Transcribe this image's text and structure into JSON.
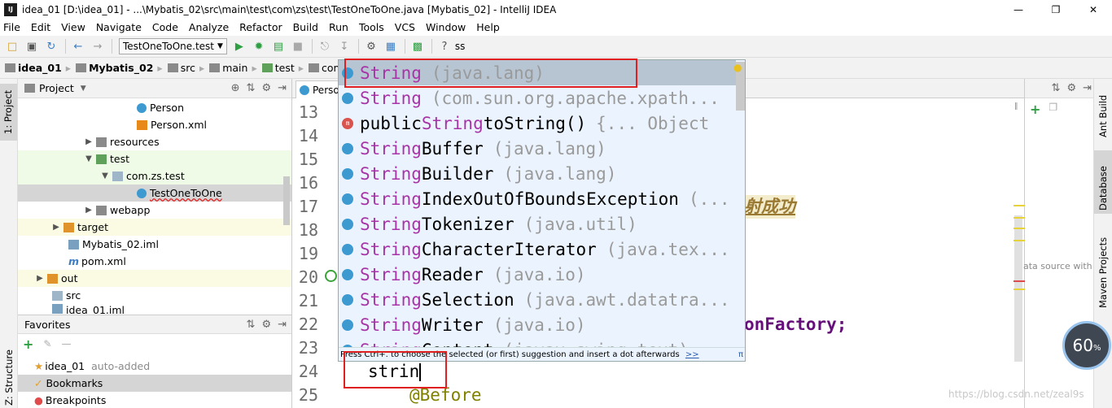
{
  "window": {
    "title": "idea_01 [D:\\idea_01] - ...\\Mybatis_02\\src\\main\\test\\com\\zs\\test\\TestOneToOne.java [Mybatis_02] - IntelliJ IDEA"
  },
  "menu": [
    "File",
    "Edit",
    "View",
    "Navigate",
    "Code",
    "Analyze",
    "Refactor",
    "Build",
    "Run",
    "Tools",
    "VCS",
    "Window",
    "Help"
  ],
  "toolbar": {
    "run_config": "TestOneToOne.test",
    "search_text": "ss"
  },
  "breadcrumb": [
    "idea_01",
    "Mybatis_02",
    "src",
    "main",
    "test",
    "com"
  ],
  "project_panel": {
    "title": "Project",
    "items": [
      {
        "label": "Person",
        "icon": "class-icon"
      },
      {
        "label": "Person.xml",
        "icon": "xml-icon"
      },
      {
        "label": "resources",
        "icon": "folder-icon"
      },
      {
        "label": "test",
        "icon": "folder-icon"
      },
      {
        "label": "com.zs.test",
        "icon": "package-icon"
      },
      {
        "label": "TestOneToOne",
        "icon": "class-icon"
      },
      {
        "label": "webapp",
        "icon": "folder-icon"
      },
      {
        "label": "target",
        "icon": "folder-icon"
      },
      {
        "label": "Mybatis_02.iml",
        "icon": "file-icon"
      },
      {
        "label": "pom.xml",
        "icon": "maven-icon"
      },
      {
        "label": "out",
        "icon": "folder-icon"
      },
      {
        "label": "src",
        "icon": "folder-icon"
      },
      {
        "label": "idea_01.iml",
        "icon": "file-icon"
      }
    ]
  },
  "favorites_panel": {
    "title": "Favorites",
    "items": [
      {
        "label": "idea_01",
        "note": "auto-added"
      },
      {
        "label": "Bookmarks",
        "note": ""
      },
      {
        "label": "Breakpoints",
        "note": ""
      }
    ]
  },
  "left_strip": {
    "project_tab": "1: Project",
    "structure_tab": "Z: Structure"
  },
  "right_strip": {
    "ant": "Ant Build",
    "database": "Database",
    "maven": "Maven Projects"
  },
  "right_panel": {
    "text": "ata source with"
  },
  "editor": {
    "tab_label": "Perso",
    "line_numbers": [
      "13",
      "14",
      "15",
      "16",
      "17",
      "18",
      "19",
      "20",
      "21",
      "22",
      "23",
      "24",
      "25"
    ],
    "frag_17": "射成功",
    "frag_22": "onFactory;",
    "typed": "strin",
    "line25": "@Before"
  },
  "completion": {
    "items": [
      {
        "match": "String",
        "rest": "",
        "hint": "(java.lang)"
      },
      {
        "match": "String",
        "rest": "",
        "hint": "(com.sun.org.apache.xpath..."
      },
      {
        "prefix": "public ",
        "match": "String",
        "rest": " toString()",
        "hint": "{... Object"
      },
      {
        "match": "String",
        "rest": "Buffer",
        "hint": "(java.lang)"
      },
      {
        "match": "String",
        "rest": "Builder",
        "hint": "(java.lang)"
      },
      {
        "match": "String",
        "rest": "IndexOutOfBoundsException",
        "hint": "(..."
      },
      {
        "match": "String",
        "rest": "Tokenizer",
        "hint": "(java.util)"
      },
      {
        "match": "String",
        "rest": "CharacterIterator",
        "hint": "(java.tex..."
      },
      {
        "match": "String",
        "rest": "Reader",
        "hint": "(java.io)"
      },
      {
        "match": "String",
        "rest": "Selection",
        "hint": "(java.awt.datatra..."
      },
      {
        "match": "String",
        "rest": "Writer",
        "hint": "(java.io)"
      },
      {
        "match": "String",
        "rest": "Content",
        "hint": "(javax.swing.text)"
      }
    ],
    "hint": "Press Ctrl+. to choose the selected (or first) suggestion and insert a dot afterwards",
    "hint_link": ">>",
    "pi": "π"
  },
  "gauge": {
    "value": "60",
    "unit": "%"
  },
  "watermark": "https://blog.csdn.net/zeal9s"
}
